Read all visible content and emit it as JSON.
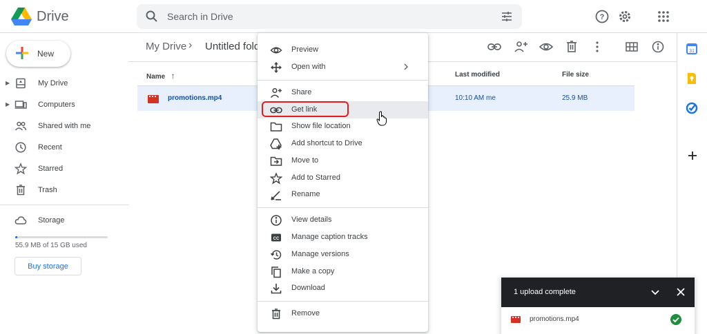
{
  "header": {
    "brand": "Drive",
    "search_placeholder": "Search in Drive"
  },
  "sidebar": {
    "new_label": "New",
    "items": [
      {
        "label": "My Drive",
        "icon": "my-drive-icon",
        "expandable": true
      },
      {
        "label": "Computers",
        "icon": "computers-icon",
        "expandable": true
      },
      {
        "label": "Shared with me",
        "icon": "shared-icon",
        "expandable": false
      },
      {
        "label": "Recent",
        "icon": "clock-icon",
        "expandable": false
      },
      {
        "label": "Starred",
        "icon": "star-icon",
        "expandable": false
      },
      {
        "label": "Trash",
        "icon": "trash-icon",
        "expandable": false
      }
    ],
    "storage_label": "Storage",
    "storage_used": "55.9 MB of 15 GB used",
    "storage_fraction": 0.01,
    "buy_label": "Buy storage"
  },
  "main": {
    "breadcrumb": [
      "My Drive",
      "Untitled fold"
    ],
    "breadcrumb_sep": "›",
    "columns": {
      "name": "Name",
      "modified": "Last modified",
      "size": "File size"
    },
    "sort_arrow": "↑",
    "rows": [
      {
        "name": "promotions.mp4",
        "modified": "10:10 AM  me",
        "size": "25.9 MB"
      }
    ]
  },
  "context_menu": {
    "items": [
      {
        "label": "Preview",
        "icon": "eye-icon"
      },
      {
        "label": "Open with",
        "icon": "open-with-icon",
        "submenu": true
      },
      {
        "label": "Share",
        "icon": "share-person-icon"
      },
      {
        "label": "Get link",
        "icon": "link-icon",
        "highlighted": true
      },
      {
        "label": "Show file location",
        "icon": "folder-icon"
      },
      {
        "label": "Add shortcut to Drive",
        "icon": "add-shortcut-icon"
      },
      {
        "label": "Move to",
        "icon": "move-to-icon"
      },
      {
        "label": "Add to Starred",
        "icon": "star-icon"
      },
      {
        "label": "Rename",
        "icon": "rename-icon"
      },
      {
        "label": "View details",
        "icon": "info-icon"
      },
      {
        "label": "Manage caption tracks",
        "icon": "cc-icon"
      },
      {
        "label": "Manage versions",
        "icon": "history-icon"
      },
      {
        "label": "Make a copy",
        "icon": "copy-icon"
      },
      {
        "label": "Download",
        "icon": "download-icon"
      },
      {
        "label": "Remove",
        "icon": "trash-icon"
      }
    ]
  },
  "toast": {
    "title": "1 upload complete",
    "file": "promotions.mp4"
  },
  "colors": {
    "accent": "#1a73e8",
    "selected_row": "#e8f0fe",
    "highlight_ring": "#e31b1b",
    "success": "#1e8e3e",
    "video_icon": "#d93025"
  }
}
